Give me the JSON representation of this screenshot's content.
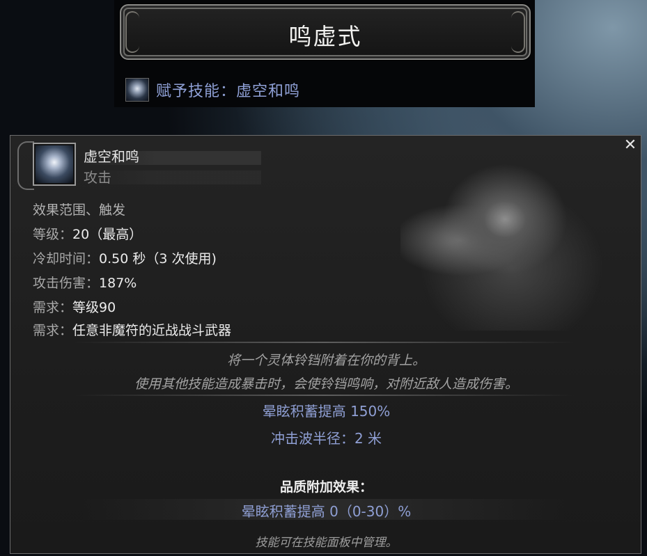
{
  "item": {
    "title": "鸣虚式",
    "grant_text": "赋予技能：虚空和鸣"
  },
  "tooltip": {
    "skill_name": "虚空和鸣",
    "skill_type": "攻击",
    "tags": "效果范围、触发",
    "stats": [
      {
        "label": "等级：",
        "value": "20（最高）"
      },
      {
        "label": "冷却时间：",
        "value": "0.50 秒（3 次使用)"
      },
      {
        "label": "攻击伤害：",
        "value": "187%"
      },
      {
        "label": "需求：",
        "value": "等级90"
      },
      {
        "label": "需求：",
        "value": "任意非魔符的近战战斗武器"
      }
    ],
    "description": [
      "将一个灵体铃铛附着在你的背上。",
      "使用其他技能造成暴击时，会使铃铛鸣响，对附近敌人造成伤害。"
    ],
    "modifiers": [
      "晕眩积蓄提高 150%",
      "冲击波半径：2 米"
    ],
    "quality_header": "品质附加效果：",
    "quality_modifier": "晕眩积蓄提高 0（0-30）%",
    "footer": "技能可在技能面板中管理。",
    "close_glyph": "✕"
  },
  "icons": {
    "skill_icon": "spirit-bell-skill-icon",
    "close_icon": "close-icon"
  },
  "colors": {
    "modifier_blue": "#8f9fd4",
    "grant_blue": "#8fa0d6",
    "panel_bg": "#1d1d1d"
  }
}
